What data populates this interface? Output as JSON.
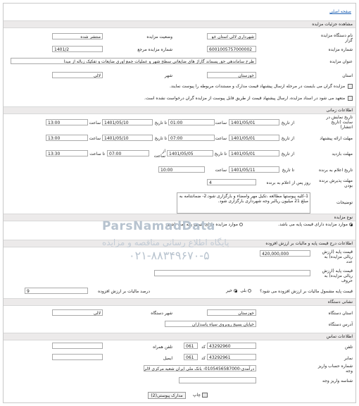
{
  "nav": {
    "home_link": "صفحه اصلی"
  },
  "section_details": "مشاهده جزئیات مزایده",
  "org": {
    "label": "نام دستگاه مزایده گزار",
    "value": "شهرداری لالی استان خو"
  },
  "status": {
    "label": "وضعیت مزایده",
    "value": "منتشر شده"
  },
  "auction_number": {
    "label": "شماره مزایده",
    "value": "6001005757000002"
  },
  "ref_number": {
    "label": "شماره مزایده مرجع",
    "value": "1401/2"
  },
  "title": {
    "label": "عنوان مزایده",
    "value": "طرح ساماندهی حق پسماند گاراژ های ضایعاتی سطح شهر و عملیات جمع اوری ضایعات و تفکیک زباله از مبدا"
  },
  "province": {
    "label": "استان",
    "value": "خوزستان"
  },
  "city": {
    "label": "شهر",
    "value": "لالی"
  },
  "notice1": "مزایده گران می بایست در مرحله ارسال پیشنهاد قیمت مدارک و مستندات مربوطه را پیوست نمایند.",
  "notice2": "متعهد می شود در اسناد مزایده، ارسال پیشنهاد قیمت از طریق قابل پیوست از مزایده گران درخواست نشده است.",
  "section_time": "اطلاعات زمانی",
  "common": {
    "from_date": "از تاریخ",
    "to_date": "تا تاریخ",
    "time": "ساعت",
    "to_time": "تا ساعت"
  },
  "publish": {
    "label": "تاریخ نمایش در سایت (تاریخ انتشار)",
    "from_date": "1401/05/01",
    "from_time": "01:00",
    "to_date": "1401/05/10",
    "to_time": "13:00"
  },
  "offer": {
    "label": "مهلت ارائه پیشنهاد",
    "from_date": "1401/05/01",
    "from_time": "07:00",
    "to_date": "1401/05/10",
    "to_time": "13:00"
  },
  "visit": {
    "label": "مهلت بازدید",
    "from_date": "1401/05/01",
    "to_date": "1401/05/05",
    "from_time_label": "از ساعت",
    "from_time": "07:00",
    "to_time": "13:30"
  },
  "opening": {
    "label": "تاریخ اعلام به برنده",
    "date": "1401/05/11",
    "time": "10:00"
  },
  "winner_period": {
    "label": "مهلت پذیرش برنده بودن",
    "value": "4",
    "unit": "روز پس از اعلام به برنده"
  },
  "description": {
    "label": "توضیحات",
    "value": "1-کلیه پیوستها مطالعه ،تکیل مهر وامضاء و بارگزاری شود.2- ضمانتنامه به مبلغ 21 میلیون ریالبر وجه شهرداری بارگزاری شود."
  },
  "section_type": "نوع مزایده",
  "type_opt1": "موارد مزایده دارای قیمت پایه می باشد.",
  "type_opt2": "موارد مزایده دارای قیمت پایه نمی باشند.",
  "section_price": "اطلاعات درج قیمت پایه و مالیات بر ارزش افزوده",
  "base_price": {
    "label": "قیمت پایه (ارزش ریالی مزایده) به عدد",
    "value": "420,000,000"
  },
  "base_price_words": {
    "label": "قیمت پایه (ارزش ریالی مزایده) به حروف",
    "value": ""
  },
  "vat_question": {
    "label": "قیمت پایه مشمول مالیات بر ارزش افزوده می شود؟",
    "yes": "بلی",
    "no": "خیر"
  },
  "vat_percent": {
    "label": "درصد مالیات بر ارزش افزوده",
    "value": "9"
  },
  "section_address": "نشانی دستگاه",
  "addr_province": {
    "label": "استان دستگاه",
    "value": "خوزستان"
  },
  "addr_city": {
    "label": "شهر دستگاه",
    "value": "لالی"
  },
  "address": {
    "label": "آدرس دستگاه",
    "value": "خیابان بسیج روبروی سپاه پاسداران"
  },
  "section_contact": "اطلاعات تماس",
  "phone": {
    "label": "تلفن",
    "code_label": "کد",
    "code": "061",
    "value": "43292960"
  },
  "mobile": {
    "label": "تلفن همراه",
    "value": ""
  },
  "fax": {
    "label": "نمابر",
    "code_label": "کد",
    "code": "061",
    "value": "43292961"
  },
  "email": {
    "label": "ایمیل",
    "value": ""
  },
  "account": {
    "label": "شماره حساب واریز وجه",
    "value": "درآمدی-0105456587000- بانک ملی ایران شعبه مرکزی لالی"
  },
  "account_id": {
    "label": "شناسه واریز وجه",
    "value": ""
  },
  "buttons": {
    "docs": "مدارک پیوستی(2)",
    "print": "چاپ"
  },
  "watermark": {
    "brand": "ParsNamadData",
    "site": "پایگاه اطلاع رسانی مناقصه و مزایده",
    "phone": "۰۲۱-۸۸۳۴۹۶۷۰-۵"
  }
}
